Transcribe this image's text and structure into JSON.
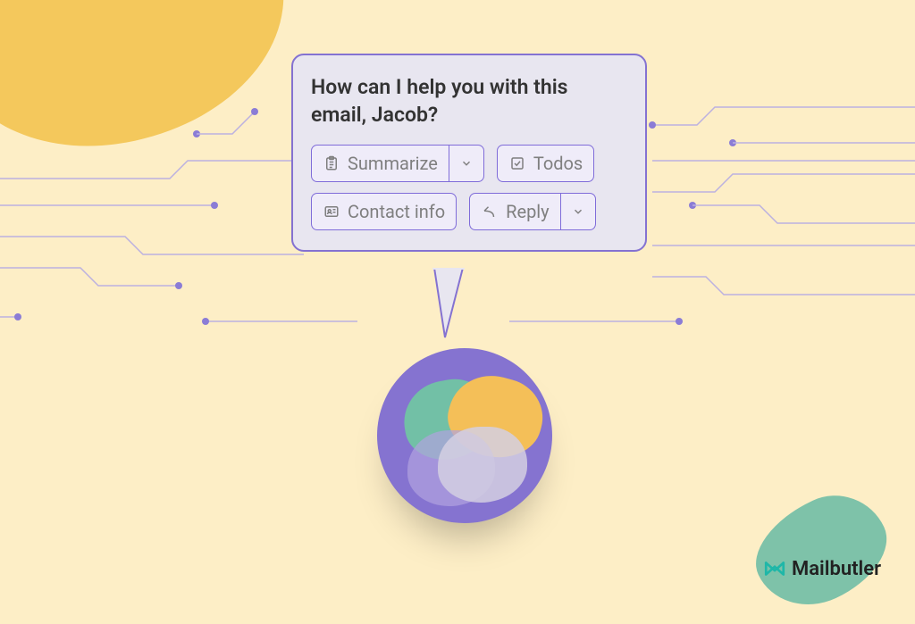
{
  "bubble": {
    "title": "How can I help you with this email, Jacob?",
    "summarize_label": "Summarize",
    "todos_label": "Todos",
    "contact_label": "Contact info",
    "reply_label": "Reply"
  },
  "brand": {
    "name": "Mailbutler"
  },
  "colors": {
    "background": "#fdeec6",
    "bubble_border": "#8472d1",
    "button_border": "#7f6cd9"
  }
}
